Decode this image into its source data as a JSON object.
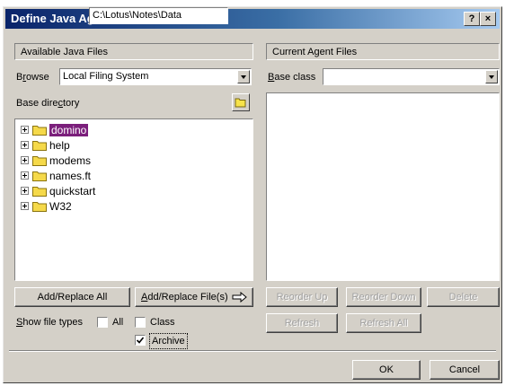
{
  "window": {
    "title": "Define Java Agent Files",
    "help_label": "?",
    "close_label": "×"
  },
  "left_panel": {
    "header": "Available Java Files",
    "browse_label_u": "r",
    "browse_label_pre": "B",
    "browse_label_post": "owse",
    "browse_value": "Local Filing System",
    "base_dir_label_pre": "Base dire",
    "base_dir_label_u": "c",
    "base_dir_label_post": "tory",
    "base_dir_value": "C:\\Lotus\\Notes\\Data",
    "tree": [
      {
        "label": "domino",
        "selected": true
      },
      {
        "label": "help",
        "selected": false
      },
      {
        "label": "modems",
        "selected": false
      },
      {
        "label": "names.ft",
        "selected": false
      },
      {
        "label": "quickstart",
        "selected": false
      },
      {
        "label": "W32",
        "selected": false
      }
    ],
    "add_replace_all": "Add/Replace All",
    "add_replace_files_u": "A",
    "add_replace_files_rest": "dd/Replace File(s)",
    "show_file_types_u": "S",
    "show_file_types_rest": "how file types",
    "types": [
      {
        "label": "All",
        "checked": false
      },
      {
        "label": "Class",
        "checked": false
      },
      {
        "label": "Archive",
        "checked": true
      }
    ]
  },
  "right_panel": {
    "header": "Current Agent Files",
    "base_class_label_u": "B",
    "base_class_label_rest": "ase class",
    "base_class_value": "",
    "reorder_up": "Reorder Up",
    "reorder_down": "Reorder Down",
    "delete": "Delete",
    "refresh": "Refresh",
    "refresh_all": "Refresh All"
  },
  "footer": {
    "ok": "OK",
    "cancel": "Cancel"
  }
}
